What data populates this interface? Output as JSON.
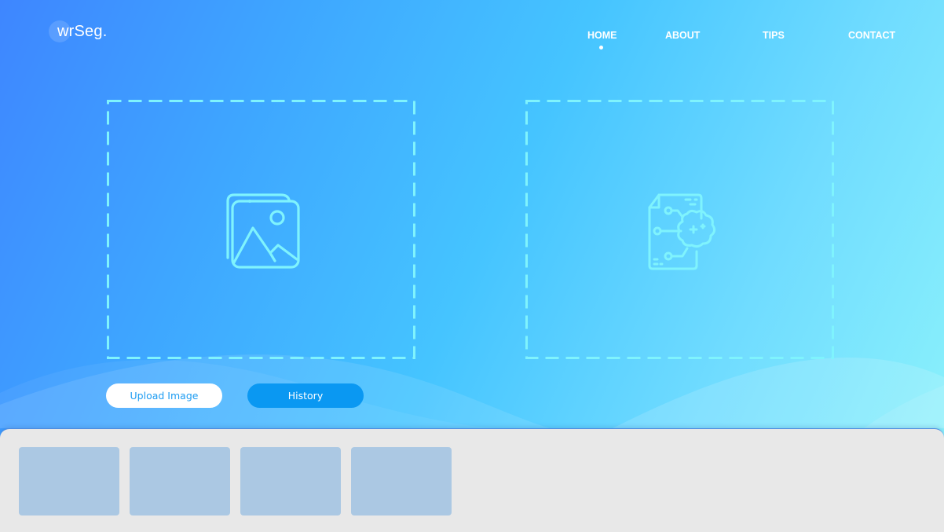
{
  "logo": {
    "text": "wrSeg."
  },
  "nav": {
    "items": [
      {
        "label": "HOME",
        "active": true
      },
      {
        "label": "ABOUT",
        "active": false
      },
      {
        "label": "TIPS",
        "active": false
      },
      {
        "label": "CONTACT",
        "active": false
      }
    ]
  },
  "dropzones": {
    "input": {
      "icon": "image-gallery-icon"
    },
    "output": {
      "icon": "document-brain-circuit-icon"
    }
  },
  "buttons": {
    "upload_label": "Upload Image",
    "history_label": "History"
  },
  "tray": {
    "thumbnail_count": 4
  },
  "colors": {
    "accent": "#0a98f2",
    "icon_stroke": "#7ff3fd",
    "thumbnail": "#abc8e3",
    "tray_bg": "#e8e8e8"
  }
}
